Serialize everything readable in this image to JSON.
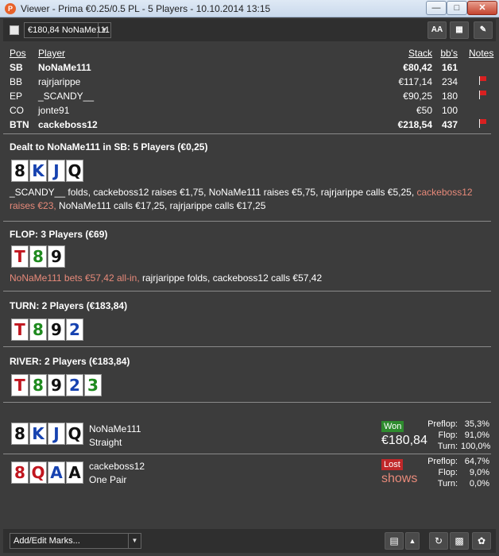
{
  "window": {
    "title": "Viewer - Prima €0.25/0.5 PL - 5 Players - 10.10.2014 13:15",
    "app_icon": "P",
    "min_icon": "minimize-icon",
    "max_icon": "maximize-icon",
    "close_icon": "close-icon"
  },
  "toolbar": {
    "hand_selector_value": "€180,84 NoNaMe111",
    "font_button": "AA",
    "grid_icon": "grid-icon",
    "edit_icon": "pencil-icon"
  },
  "players": {
    "headers": {
      "pos": "Pos",
      "player": "Player",
      "stack": "Stack",
      "bbs": "bb's",
      "notes": "Notes"
    },
    "rows": [
      {
        "pos": "SB",
        "name": "NoNaMe111",
        "stack": "€80,42",
        "bbs": "161",
        "flag": false,
        "bold": true
      },
      {
        "pos": "BB",
        "name": "rajrjarippe",
        "stack": "€117,14",
        "bbs": "234",
        "flag": true,
        "bold": false
      },
      {
        "pos": "EP",
        "name": "_SCANDY__",
        "stack": "€90,25",
        "bbs": "180",
        "flag": true,
        "bold": false
      },
      {
        "pos": "CO",
        "name": "jonte91",
        "stack": "€50",
        "bbs": "100",
        "flag": false,
        "bold": false
      },
      {
        "pos": "BTN",
        "name": "cackeboss12",
        "stack": "€218,54",
        "bbs": "437",
        "flag": true,
        "bold": true
      }
    ]
  },
  "preflop": {
    "title": "Dealt to NoNaMe111 in SB: 5 Players (€0,25)",
    "cards": [
      {
        "rank": "8",
        "suit": "s"
      },
      {
        "rank": "K",
        "suit": "d"
      },
      {
        "rank": "J",
        "suit": "d"
      },
      {
        "rank": "Q",
        "suit": "s"
      }
    ],
    "action_1": "_SCANDY__ folds, cackeboss12 raises €1,75, NoNaMe111 raises €5,75, rajrjarippe calls €5,25, ",
    "action_hl": "cackeboss12 raises €23,",
    "action_2": " NoNaMe111 calls €17,25, rajrjarippe calls €17,25"
  },
  "flop": {
    "title": "FLOP: 3 Players (€69)",
    "cards": [
      {
        "rank": "T",
        "suit": "h"
      },
      {
        "rank": "8",
        "suit": "c"
      },
      {
        "rank": "9",
        "suit": "s"
      }
    ],
    "action_hl": "NoNaMe111 bets €57,42 all-in,",
    "action_2": " rajrjarippe folds, cackeboss12 calls €57,42"
  },
  "turn": {
    "title": "TURN: 2 Players (€183,84)",
    "cards": [
      {
        "rank": "T",
        "suit": "h"
      },
      {
        "rank": "8",
        "suit": "c"
      },
      {
        "rank": "9",
        "suit": "s"
      },
      {
        "rank": "2",
        "suit": "d"
      }
    ]
  },
  "river": {
    "title": "RIVER: 2 Players (€183,84)",
    "cards": [
      {
        "rank": "T",
        "suit": "h"
      },
      {
        "rank": "8",
        "suit": "c"
      },
      {
        "rank": "9",
        "suit": "s"
      },
      {
        "rank": "2",
        "suit": "d"
      },
      {
        "rank": "3",
        "suit": "c"
      }
    ]
  },
  "results": [
    {
      "player": "NoNaMe111",
      "hand_name": "Straight",
      "badge": "Won",
      "amount": "€180,84",
      "cards": [
        {
          "rank": "8",
          "suit": "s"
        },
        {
          "rank": "K",
          "suit": "d"
        },
        {
          "rank": "J",
          "suit": "d"
        },
        {
          "rank": "Q",
          "suit": "s"
        }
      ],
      "stats": [
        {
          "label": "Preflop:",
          "value": "35,3%"
        },
        {
          "label": "Flop:",
          "value": "91,0%"
        },
        {
          "label": "Turn:",
          "value": "100,0%"
        }
      ]
    },
    {
      "player": "cackeboss12",
      "hand_name": "One Pair",
      "badge": "Lost",
      "amount": "shows",
      "cards": [
        {
          "rank": "8",
          "suit": "h"
        },
        {
          "rank": "Q",
          "suit": "h"
        },
        {
          "rank": "A",
          "suit": "d"
        },
        {
          "rank": "A",
          "suit": "s"
        }
      ],
      "stats": [
        {
          "label": "Preflop:",
          "value": "64,7%"
        },
        {
          "label": "Flop:",
          "value": "9,0%"
        },
        {
          "label": "Turn:",
          "value": "0,0%"
        }
      ]
    }
  ],
  "bottombar": {
    "marks_select": "Add/Edit Marks...",
    "clipboard_icon": "clipboard-icon",
    "order_icon": "sort-arrows-icon",
    "refresh_icon": "refresh-icon",
    "save_icon": "save-icon",
    "share_icon": "twitter-icon"
  },
  "colors": {
    "background": "#3c3c3c",
    "highlight_action": "#e88a7a",
    "won_badge": "#2e8b2e",
    "lost_badge": "#c0282a",
    "spade": "#111111",
    "heart": "#c0161f",
    "diamond": "#1642b0",
    "club": "#1e8a1e"
  }
}
